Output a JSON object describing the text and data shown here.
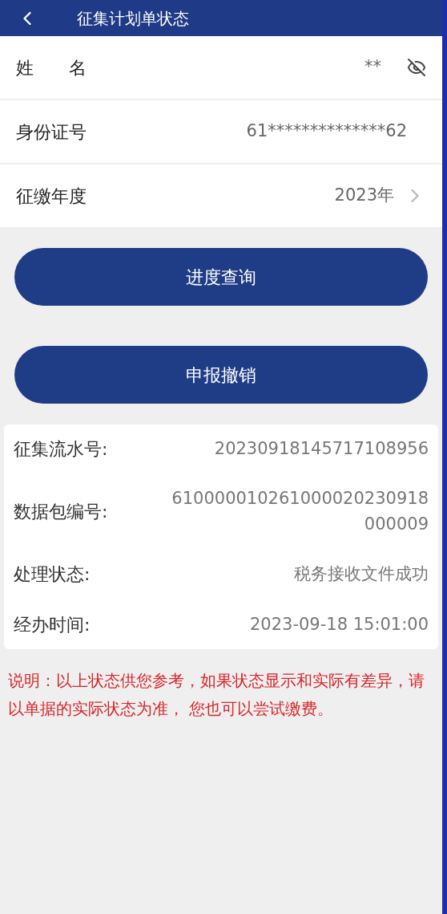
{
  "header": {
    "title": "征集计划单状态"
  },
  "fields": [
    {
      "kind": "masked",
      "label": "姓　　名",
      "value": "**",
      "masked": true
    },
    {
      "kind": "plain",
      "label": "身份证号",
      "value": "61**************62"
    },
    {
      "kind": "select",
      "label": "征缴年度",
      "value": "2023年"
    }
  ],
  "buttons": [
    "进度查询",
    "申报撤销"
  ],
  "details": [
    {
      "label": "征集流水号:",
      "value": "20230918145717108956"
    },
    {
      "label": "数据包编号:",
      "value": "610000010261000020230918000009"
    },
    {
      "label": "处理状态:",
      "value": "税务接收文件成功"
    },
    {
      "label": "经办时间:",
      "value": "2023-09-18 15:01:00"
    }
  ],
  "note": "说明：以上状态供您参考，如果状态显示和实际有差异，请以单据的实际状态为准， 您也可以尝试缴费。"
}
